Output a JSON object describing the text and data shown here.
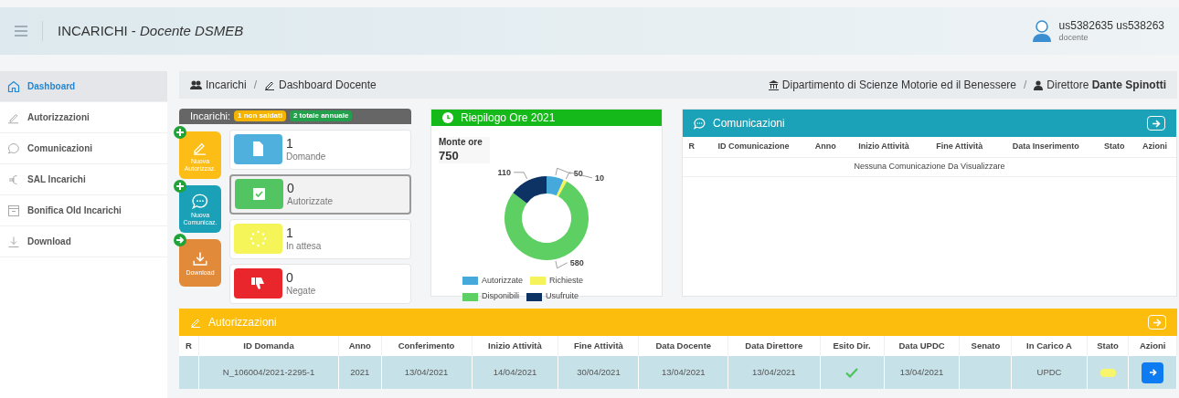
{
  "header": {
    "title": "INCARICHI - *Docente DSMEB*",
    "user": "us5382635 us538263",
    "role": "docente"
  },
  "sidebar": {
    "items": [
      {
        "label": "Dashboard",
        "selected": true
      },
      {
        "label": "Autorizzazioni",
        "selected": false
      },
      {
        "label": "Comunicazioni",
        "selected": false
      },
      {
        "label": "SAL Incarichi",
        "selected": false
      },
      {
        "label": "Bonifica Old Incarichi",
        "selected": false
      },
      {
        "label": "Download",
        "selected": false
      }
    ]
  },
  "breadcrumb": {
    "items": [
      "Incarichi",
      "Dashboard Docente"
    ],
    "separators": [
      "/",
      "/"
    ],
    "department": "Dipartimento di Scienze Motorie ed il Benessere",
    "director": "Direttore **Dante Spinotti**"
  },
  "incarichi": {
    "title": "Incarichi:",
    "badges": [
      {
        "text": "1 non saldati",
        "color": "#f5b400"
      },
      {
        "text": "2 totale annuale",
        "color": "#22a04b"
      }
    ],
    "actions": [
      {
        "label": "Nuova Autorizzaz.",
        "color": "#fbbd16"
      },
      {
        "label": "Nuova Comunicaz.",
        "color": "#1aa1b8"
      },
      {
        "label": "Download",
        "color": "#e08a3a"
      }
    ],
    "stats": [
      {
        "count": "1",
        "label": "Domande",
        "color": "#4fb0dd",
        "selected": false
      },
      {
        "count": "0",
        "label": "Autorizzate",
        "color": "#52c462",
        "selected": true
      },
      {
        "count": "1",
        "label": "In attesa",
        "color": "#f5f55a",
        "selected": false
      },
      {
        "count": "0",
        "label": "Negate",
        "color": "#e8262b",
        "selected": false
      }
    ]
  },
  "riepilogo": {
    "title": "Riepilogo Ore 2021",
    "monte_label": "Monte ore",
    "monte_value": "750",
    "chart_data": {
      "type": "donut",
      "categories": [
        "Autorizzate",
        "Richieste",
        "Disponibili",
        "Usufruite"
      ],
      "series": [
        {
          "colors": [
            "#45a9dc",
            "#f5f35a",
            "#5ecf62",
            "#0c3364"
          ],
          "values": [
            50,
            10,
            580,
            110
          ]
        }
      ],
      "data_labels": true,
      "legend": "bottom"
    }
  },
  "comunicazioni": {
    "title": "Comunicazioni",
    "columns": [
      "R",
      "ID Comunicazione",
      "Anno",
      "Inizio Attività",
      "Fine Attività",
      "Data Inserimento",
      "Stato",
      "Azioni"
    ],
    "empty_message": "Nessuna Comunicazione Da Visualizzare"
  },
  "autorizzazioni": {
    "title": "Autorizzazioni",
    "columns": [
      "R",
      "ID Domanda",
      "Anno",
      "Conferimento",
      "Inizio Attività",
      "Fine Attività",
      "Data Docente",
      "Data Direttore",
      "Esito Dir.",
      "Data UPDC",
      "Senato",
      "In Carico A",
      "Stato",
      "Azioni"
    ],
    "rows": [
      {
        "selected": true,
        "cells": [
          {
            "kind": "empty"
          },
          {
            "kind": "text",
            "text": "N_106004/2021-2295-1"
          },
          {
            "kind": "text",
            "text": "2021"
          },
          {
            "kind": "text",
            "text": "13/04/2021"
          },
          {
            "kind": "text",
            "text": "14/04/2021"
          },
          {
            "kind": "text",
            "text": "30/04/2021"
          },
          {
            "kind": "text",
            "text": "13/04/2021"
          },
          {
            "kind": "text",
            "text": "13/04/2021"
          },
          {
            "kind": "check"
          },
          {
            "kind": "text",
            "text": "13/04/2021"
          },
          {
            "kind": "empty"
          },
          {
            "kind": "text",
            "text": "UPDC"
          },
          {
            "kind": "status",
            "color": "#f7f56b"
          },
          {
            "kind": "action"
          }
        ]
      }
    ]
  }
}
